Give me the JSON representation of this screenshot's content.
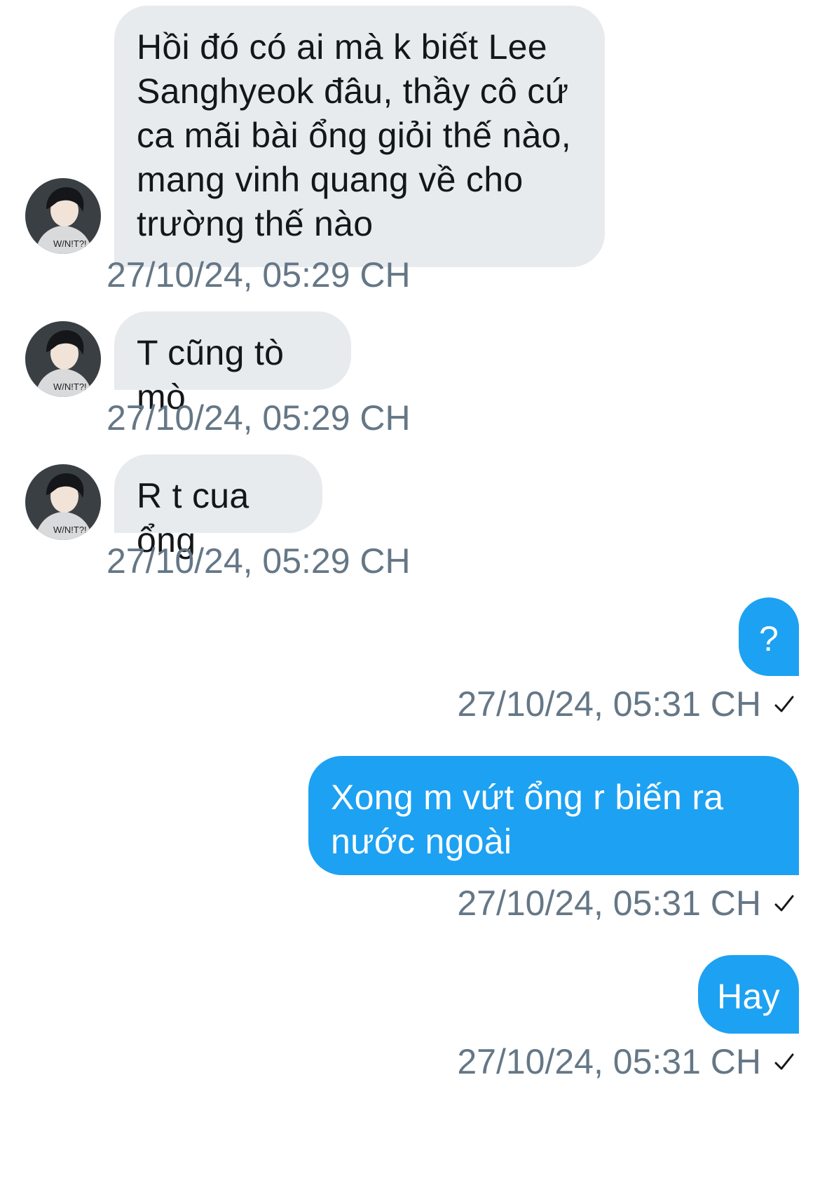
{
  "thread": {
    "messages": [
      {
        "direction": "in",
        "avatar": "avatar-icon",
        "text": "Hồi đó có ai mà k biết Lee Sanghyeok đâu, thầy cô cứ ca mãi bài ổng giỏi thế nào, mang vinh quang về cho trường thế nào",
        "time": "27/10/24, 05:29 CH"
      },
      {
        "direction": "in",
        "avatar": "avatar-icon",
        "text": "T cũng tò mò",
        "time": "27/10/24, 05:29 CH"
      },
      {
        "direction": "in",
        "avatar": "avatar-icon",
        "text": "R t cua ổng",
        "time": "27/10/24, 05:29 CH"
      },
      {
        "direction": "out",
        "text": "?",
        "time": "27/10/24, 05:31 CH",
        "status_icon": "check-icon"
      },
      {
        "direction": "out",
        "text": "Xong m vứt ổng r biến ra nước ngoài",
        "time": "27/10/24, 05:31 CH",
        "status_icon": "check-icon"
      },
      {
        "direction": "out",
        "text": "Hay",
        "time": "27/10/24, 05:31 CH",
        "status_icon": "check-icon"
      }
    ]
  },
  "colors": {
    "incoming_bubble": "#e8ebee",
    "outgoing_bubble": "#1da1f2",
    "timestamp": "#657786",
    "incoming_text": "#14171a",
    "outgoing_text": "#ffffff"
  }
}
